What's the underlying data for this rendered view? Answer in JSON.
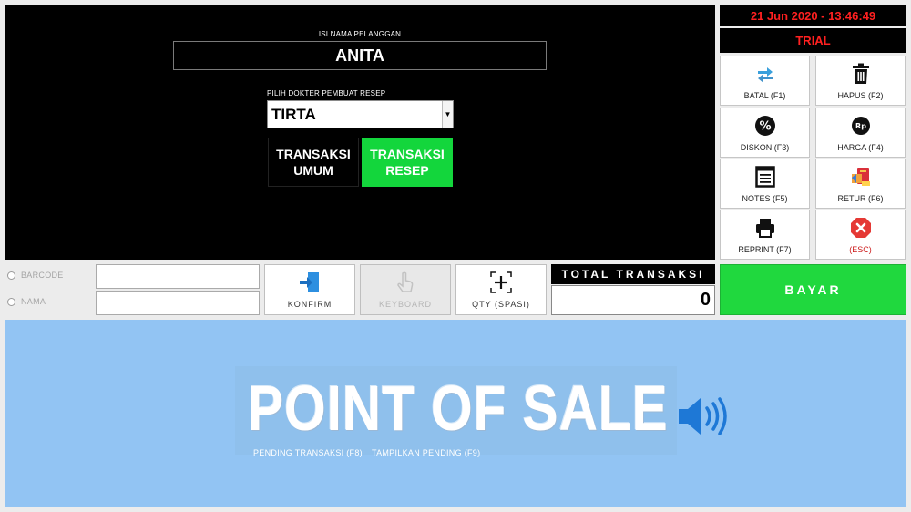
{
  "customer": {
    "caption": "ISI NAMA PELANGGAN",
    "name": "ANITA"
  },
  "doctor": {
    "caption": "PILIH DOKTER PEMBUAT RESEP",
    "selected": "TIRTA"
  },
  "transaction_types": {
    "umum_line1": "TRANSAKSI",
    "umum_line2": "UMUM",
    "resep_line1": "TRANSAKSI",
    "resep_line2": "RESEP"
  },
  "status": {
    "datetime": "21 Jun 2020 - 13:46:49",
    "license": "TRIAL"
  },
  "function_buttons": [
    {
      "label": "BATAL (F1)",
      "icon": "refresh-icon"
    },
    {
      "label": "HAPUS (F2)",
      "icon": "trash-icon"
    },
    {
      "label": "DISKON (F3)",
      "icon": "percent-icon"
    },
    {
      "label": "HARGA (F4)",
      "icon": "price-tag-icon"
    },
    {
      "label": "NOTES (F5)",
      "icon": "notes-icon"
    },
    {
      "label": "RETUR (F6)",
      "icon": "return-icon"
    },
    {
      "label": "REPRINT (F7)",
      "icon": "printer-icon"
    },
    {
      "label": "(ESC)",
      "icon": "close-icon"
    }
  ],
  "search": {
    "barcode_label": "BARCODE",
    "name_label": "NAMA",
    "barcode_value": "",
    "name_value": ""
  },
  "actions": {
    "konfirm": "KONFIRM",
    "keyboard": "KEYBOARD",
    "qty": "QTY (SPASI)",
    "bayar": "BAYAR"
  },
  "total": {
    "label": "TOTAL TRANSAKSI",
    "value": "0"
  },
  "banner": {
    "title": "POINT OF SALE",
    "pending": "PENDING TRANSAKSI (F8)",
    "show_pending": "TAMPILKAN PENDING (F9)"
  },
  "colors": {
    "accent_green": "#20d83e",
    "alert_red": "#ff2020",
    "banner_blue": "#92c4f3"
  }
}
